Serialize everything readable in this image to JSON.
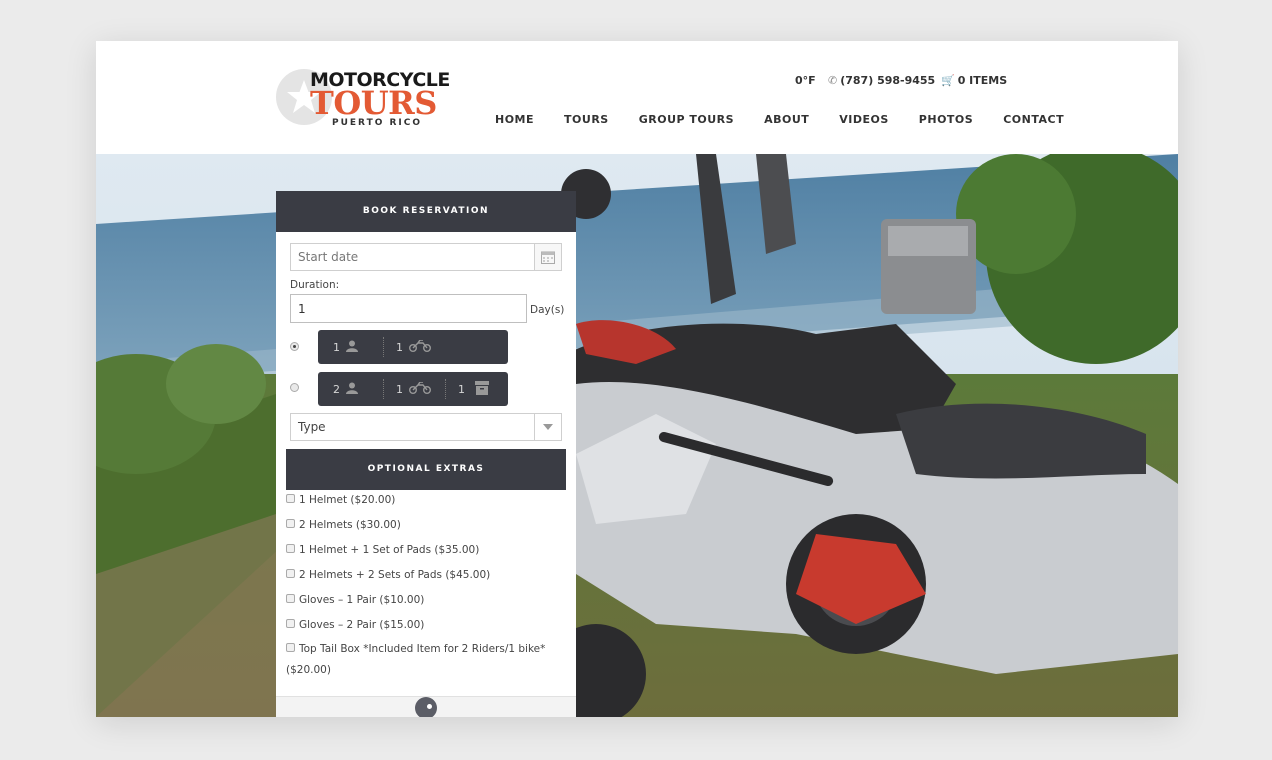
{
  "header": {
    "logo": {
      "line1": "MOTORCYCLE",
      "line2": "TOURS",
      "line3": "PUERTO RICO"
    },
    "temperature": "0°F",
    "phone": "(787) 598-9455",
    "cart": "0 ITEMS",
    "nav": [
      "HOME",
      "TOURS",
      "GROUP TOURS",
      "ABOUT",
      "VIDEOS",
      "PHOTOS",
      "CONTACT"
    ]
  },
  "booking": {
    "title": "BOOK RESERVATION",
    "start_date_placeholder": "Start date",
    "duration_label": "Duration:",
    "duration_value": "1",
    "duration_unit": "Day(s)",
    "options": [
      {
        "riders": "1",
        "bikes": "1",
        "selected": true
      },
      {
        "riders": "2",
        "bikes": "1",
        "boxes": "1",
        "selected": false
      }
    ],
    "type_select": "Type",
    "extras_title": "OPTIONAL EXTRAS",
    "extras": [
      "1 Helmet ($20.00)",
      "2 Helmets ($30.00)",
      "1 Helmet + 1 Set of Pads ($35.00)",
      "2 Helmets + 2 Sets of Pads ($45.00)",
      "Gloves – 1 Pair ($10.00)",
      "Gloves – 2 Pair ($15.00)",
      "Top Tail Box *Included Item for 2 Riders/1 bike* ($20.00)"
    ]
  },
  "colors": {
    "brand_orange": "#e35a34",
    "dark_panel": "#3a3c44"
  }
}
